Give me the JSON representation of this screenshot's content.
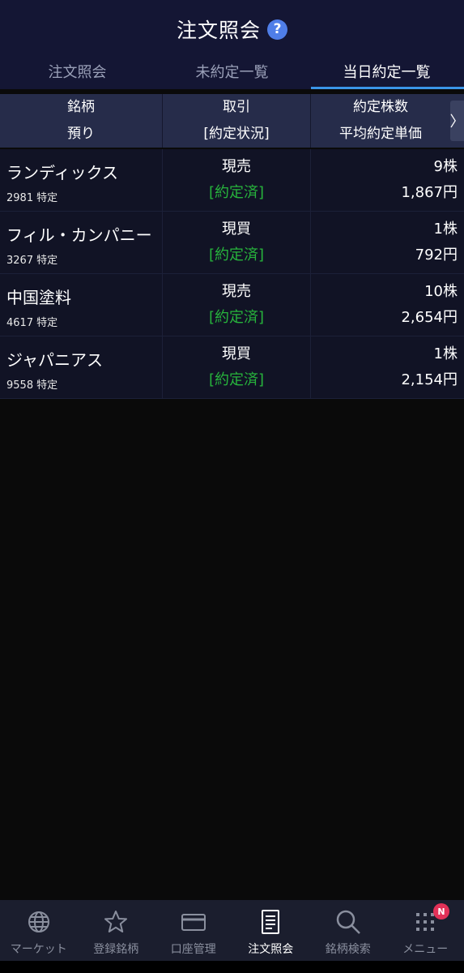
{
  "header": {
    "title": "注文照会",
    "help_icon": "?"
  },
  "tabs": [
    {
      "label": "注文照会",
      "active": false
    },
    {
      "label": "未約定一覧",
      "active": false
    },
    {
      "label": "当日約定一覧",
      "active": true
    }
  ],
  "table": {
    "headers": {
      "col1": [
        "銘柄",
        "預り"
      ],
      "col2": [
        "取引",
        "[約定状況]"
      ],
      "col3": [
        "約定株数",
        "平均約定単価"
      ]
    },
    "more_arrow": "〉",
    "rows": [
      {
        "name": "ランディックス",
        "code": "2981",
        "account": "特定",
        "trade": "現売",
        "status": "[約定済]",
        "qty": "9株",
        "price": "1,867円"
      },
      {
        "name": "フィル・カンパニー",
        "code": "3267",
        "account": "特定",
        "trade": "現買",
        "status": "[約定済]",
        "qty": "1株",
        "price": "792円"
      },
      {
        "name": "中国塗料",
        "code": "4617",
        "account": "特定",
        "trade": "現売",
        "status": "[約定済]",
        "qty": "10株",
        "price": "2,654円"
      },
      {
        "name": "ジャパニアス",
        "code": "9558",
        "account": "特定",
        "trade": "現買",
        "status": "[約定済]",
        "qty": "1株",
        "price": "2,154円"
      }
    ]
  },
  "bottom_nav": [
    {
      "label": "マーケット",
      "icon": "globe-icon",
      "active": false
    },
    {
      "label": "登録銘柄",
      "icon": "star-icon",
      "active": false
    },
    {
      "label": "口座管理",
      "icon": "card-icon",
      "active": false
    },
    {
      "label": "注文照会",
      "icon": "document-icon",
      "active": true
    },
    {
      "label": "銘柄検索",
      "icon": "search-icon",
      "active": false
    },
    {
      "label": "メニュー",
      "icon": "grid-icon",
      "active": false,
      "badge": "N"
    }
  ],
  "colors": {
    "header_bg": "#141634",
    "table_header_bg": "#262c4a",
    "row_bg": "#111325",
    "status_green": "#27b43c",
    "tab_indicator": "#3a95e8",
    "badge_red": "#e23158"
  }
}
